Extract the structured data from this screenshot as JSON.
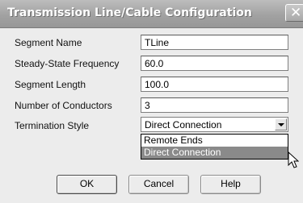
{
  "window": {
    "title": "Transmission Line/Cable Configuration",
    "close_icon": "close-x-icon"
  },
  "fields": [
    {
      "label": "Segment Name",
      "value": "TLine"
    },
    {
      "label": "Steady-State Frequency",
      "value": "60.0"
    },
    {
      "label": "Segment Length",
      "value": "100.0"
    },
    {
      "label": "Number of Conductors",
      "value": "3"
    }
  ],
  "termination": {
    "label": "Termination Style",
    "selected": "Direct Connection",
    "options": [
      "Remote Ends",
      "Direct Connection"
    ],
    "highlighted_option": "Direct Connection"
  },
  "buttons": {
    "ok": "OK",
    "cancel": "Cancel",
    "help": "Help"
  },
  "colors": {
    "title_bar": "#a2a2a2",
    "highlight": "#8a8a8a"
  }
}
